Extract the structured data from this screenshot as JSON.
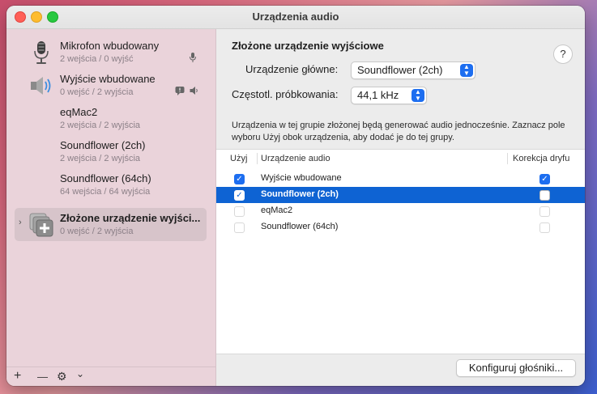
{
  "window": {
    "title": "Urządzenia audio"
  },
  "sidebar": {
    "devices": [
      {
        "name": "Mikrofon wbudowany",
        "sub": "2 wejścia / 0 wyjść",
        "icon": "microphone-icon",
        "selected": false
      },
      {
        "name": "Wyjście wbudowane",
        "sub": "0 wejść / 2 wyjścia",
        "icon": "speaker-icon",
        "selected": false
      },
      {
        "name": "eqMac2",
        "sub": "2 wejścia / 2 wyjścia",
        "icon": "",
        "selected": false
      },
      {
        "name": "Soundflower (2ch)",
        "sub": "2 wejścia / 2 wyjścia",
        "icon": "",
        "selected": false
      },
      {
        "name": "Soundflower (64ch)",
        "sub": "64 wejścia / 64 wyjścia",
        "icon": "",
        "selected": false
      },
      {
        "name": "Złożone urządzenie wyjści...",
        "sub": "0 wejść / 2 wyjścia",
        "icon": "aggregate-device-icon",
        "selected": true
      }
    ],
    "footer": {
      "add": "+",
      "remove": "—",
      "gear": "⚙",
      "chevron": "⌄"
    }
  },
  "main": {
    "header": "Złożone urządzenie wyjściowe",
    "help": "?",
    "master_label": "Urządzenie główne:",
    "master_value": "Soundflower (2ch)",
    "rate_label": "Częstotl. próbkowania:",
    "rate_value": "44,1 kHz",
    "description": "Urządzenia w tej grupie złożonej będą generować audio jednocześnie. Zaznacz pole wyboru Użyj obok urządzenia, aby dodać je do tej grupy.",
    "table": {
      "col_use": "Użyj",
      "col_device": "Urządzenie audio",
      "col_drift": "Korekcja dryfu",
      "rows": [
        {
          "use": true,
          "device": "Wyjście wbudowane",
          "drift": true,
          "selected": false
        },
        {
          "use": true,
          "device": "Soundflower (2ch)",
          "drift": false,
          "selected": true
        },
        {
          "use": false,
          "device": "eqMac2",
          "drift": false,
          "selected": false
        },
        {
          "use": false,
          "device": "Soundflower (64ch)",
          "drift": false,
          "selected": false
        }
      ]
    },
    "configure_button": "Konfiguruj głośniki..."
  },
  "colors": {
    "accent": "#1d6ef0",
    "selection": "#0e63d3",
    "sidebar": "#ead3da"
  }
}
